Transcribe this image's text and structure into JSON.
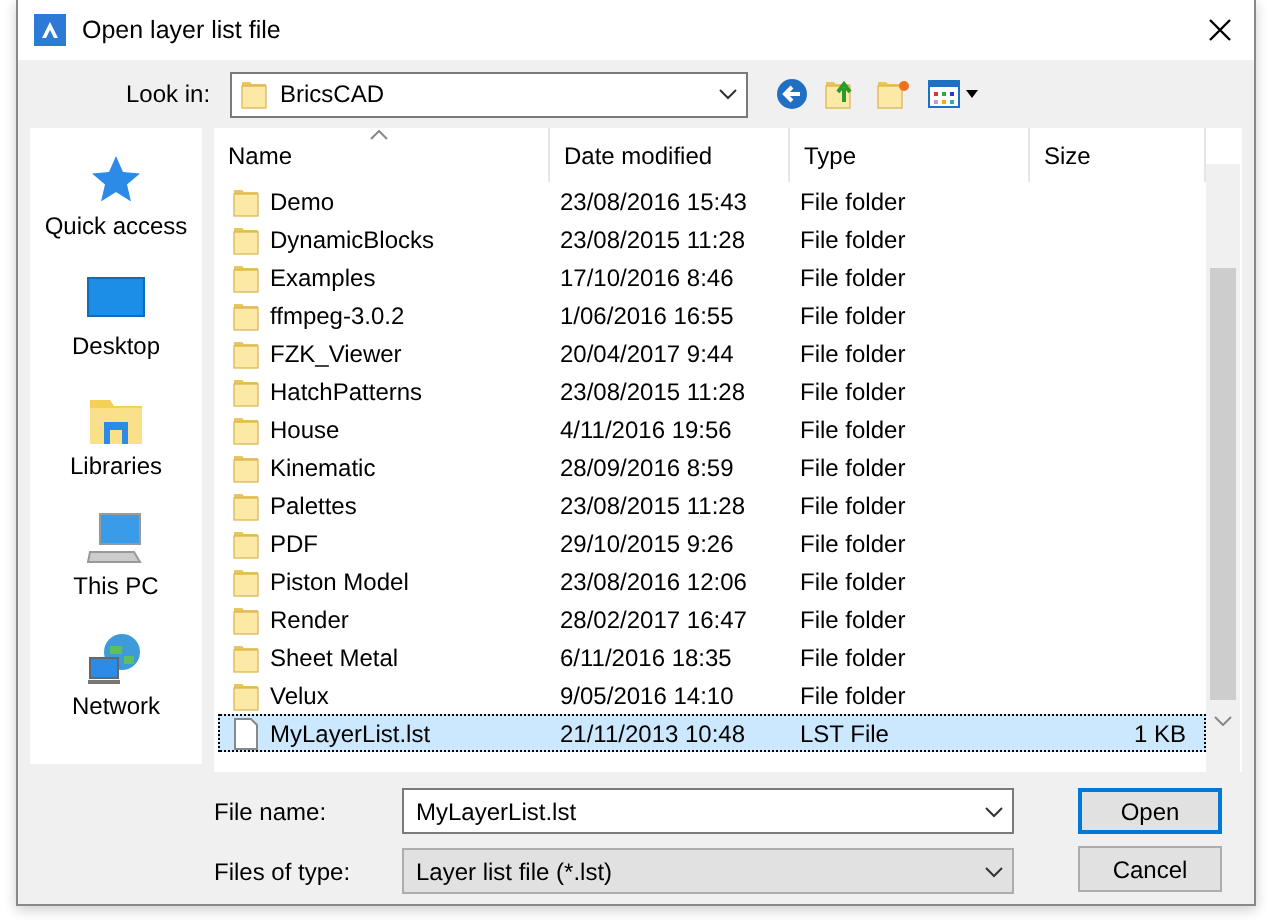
{
  "window": {
    "title": "Open layer list file"
  },
  "look_in": {
    "label": "Look in:",
    "value": "BricsCAD"
  },
  "places": [
    {
      "label": "Quick access",
      "kind": "star"
    },
    {
      "label": "Desktop",
      "kind": "desktop"
    },
    {
      "label": "Libraries",
      "kind": "libraries"
    },
    {
      "label": "This PC",
      "kind": "pc"
    },
    {
      "label": "Network",
      "kind": "network"
    }
  ],
  "columns": [
    "Name",
    "Date modified",
    "Type",
    "Size"
  ],
  "rows": [
    {
      "name": "Demo",
      "date": "23/08/2016 15:43",
      "type": "File folder",
      "kind": "folder",
      "selected": false
    },
    {
      "name": "DynamicBlocks",
      "date": "23/08/2015 11:28",
      "type": "File folder",
      "kind": "folder",
      "selected": false
    },
    {
      "name": "Examples",
      "date": "17/10/2016 8:46",
      "type": "File folder",
      "kind": "folder",
      "selected": false
    },
    {
      "name": "ffmpeg-3.0.2",
      "date": "1/06/2016 16:55",
      "type": "File folder",
      "kind": "folder",
      "selected": false
    },
    {
      "name": "FZK_Viewer",
      "date": "20/04/2017 9:44",
      "type": "File folder",
      "kind": "folder",
      "selected": false
    },
    {
      "name": "HatchPatterns",
      "date": "23/08/2015 11:28",
      "type": "File folder",
      "kind": "folder",
      "selected": false
    },
    {
      "name": "House",
      "date": "4/11/2016 19:56",
      "type": "File folder",
      "kind": "folder",
      "selected": false
    },
    {
      "name": "Kinematic",
      "date": "28/09/2016 8:59",
      "type": "File folder",
      "kind": "folder",
      "selected": false
    },
    {
      "name": "Palettes",
      "date": "23/08/2015 11:28",
      "type": "File folder",
      "kind": "folder",
      "selected": false
    },
    {
      "name": "PDF",
      "date": "29/10/2015 9:26",
      "type": "File folder",
      "kind": "folder",
      "selected": false
    },
    {
      "name": "Piston Model",
      "date": "23/08/2016 12:06",
      "type": "File folder",
      "kind": "folder",
      "selected": false
    },
    {
      "name": "Render",
      "date": "28/02/2017 16:47",
      "type": "File folder",
      "kind": "folder",
      "selected": false
    },
    {
      "name": "Sheet Metal",
      "date": "6/11/2016 18:35",
      "type": "File folder",
      "kind": "folder",
      "selected": false
    },
    {
      "name": "Velux",
      "date": "9/05/2016 14:10",
      "type": "File folder",
      "kind": "folder",
      "selected": false
    },
    {
      "name": "MyLayerList.lst",
      "date": "21/11/2013 10:48",
      "type": "LST File",
      "size": "1 KB",
      "kind": "file",
      "selected": true
    }
  ],
  "file_name": {
    "label": "File name:",
    "value": "MyLayerList.lst"
  },
  "file_type": {
    "label": "Files of type:",
    "value": "Layer list file (*.lst)"
  },
  "buttons": [
    "Open",
    "Cancel"
  ]
}
